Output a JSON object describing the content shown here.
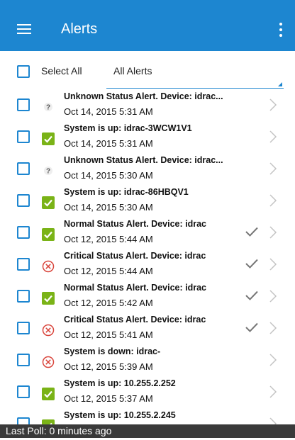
{
  "appbar": {
    "title": "Alerts",
    "menu_icon": "hamburger-menu-icon",
    "overflow_icon": "more-vertical-icon",
    "color": "#1d86d0"
  },
  "toolbar": {
    "select_all": "Select All",
    "filter_value": "All Alerts"
  },
  "alerts": [
    {
      "status": "unknown",
      "title": "Unknown Status Alert. Device: idrac...",
      "time": "Oct 14, 2015 5:31 AM",
      "acknowledged": false
    },
    {
      "status": "ok",
      "title": "System is up: idrac-3WCW1V1",
      "time": "Oct 14, 2015 5:31 AM",
      "acknowledged": false
    },
    {
      "status": "unknown",
      "title": "Unknown Status Alert. Device: idrac...",
      "time": "Oct 14, 2015 5:30 AM",
      "acknowledged": false
    },
    {
      "status": "ok",
      "title": "System is up: idrac-86HBQV1",
      "time": "Oct 14, 2015 5:30 AM",
      "acknowledged": false
    },
    {
      "status": "ok",
      "title": "Normal Status Alert. Device: idrac",
      "time": "Oct 12, 2015 5:44 AM",
      "acknowledged": true
    },
    {
      "status": "critical",
      "title": "Critical Status Alert. Device: idrac",
      "time": "Oct 12, 2015 5:44 AM",
      "acknowledged": true
    },
    {
      "status": "ok",
      "title": "Normal Status Alert. Device: idrac",
      "time": "Oct 12, 2015 5:42 AM",
      "acknowledged": true
    },
    {
      "status": "critical",
      "title": "Critical Status Alert. Device: idrac",
      "time": "Oct 12, 2015 5:41 AM",
      "acknowledged": true
    },
    {
      "status": "critical",
      "title": "System is down: idrac-",
      "time": "Oct 12, 2015 5:39 AM",
      "acknowledged": false
    },
    {
      "status": "ok",
      "title": "System is up: 10.255.2.252",
      "time": "Oct 12, 2015 5:37 AM",
      "acknowledged": false
    },
    {
      "status": "ok",
      "title": "System is up: 10.255.2.245",
      "time": "",
      "acknowledged": false
    }
  ],
  "status_colors": {
    "ok": "#7ab317",
    "critical": "#d9453c",
    "unknown": "#555555"
  },
  "footer": {
    "text": "Last Poll: 0 minutes ago"
  }
}
